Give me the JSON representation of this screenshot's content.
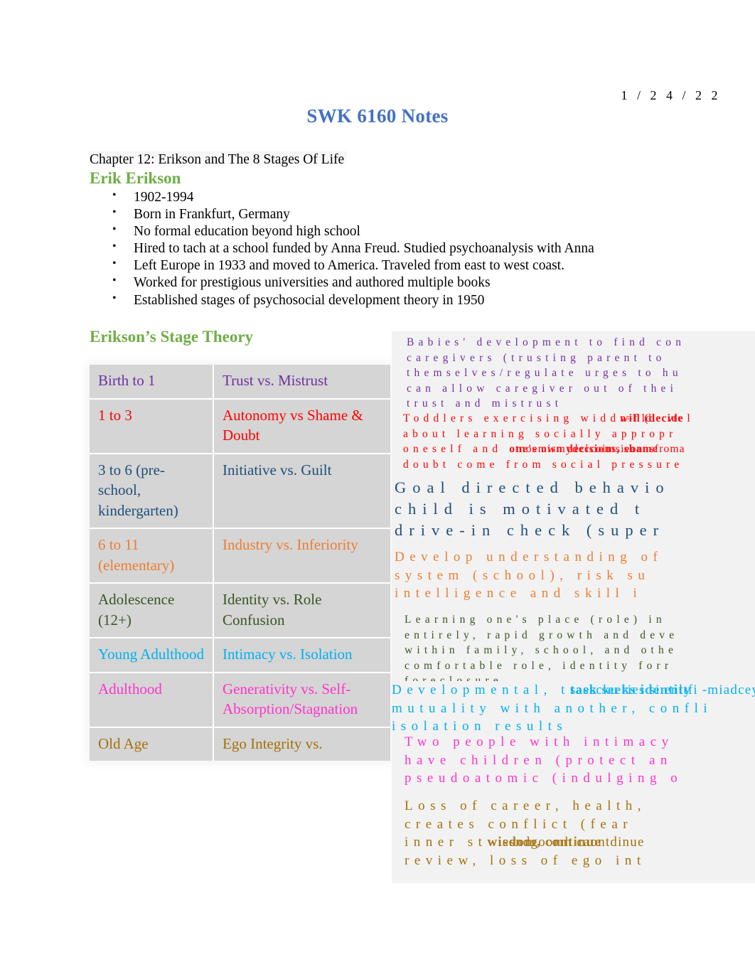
{
  "header": {
    "date": "1 / 2 4 / 2 2",
    "title": "SWK 6160 Notes"
  },
  "chapter": {
    "line": "Chapter 12: Erikson and The 8 Stages Of Life"
  },
  "sections": {
    "erik_erikson_heading": "Erik Erikson",
    "stage_theory_heading": "Erikson’s Stage Theory"
  },
  "bio_bullets": [
    "1902-1994",
    "Born in Frankfurt, Germany",
    "No formal education beyond high school",
    "Hired to tach at a school funded by Anna Freud. Studied psychoanalysis with Anna",
    "Left Europe in 1933 and moved to America. Traveled from east to west coast.",
    "Worked for prestigious universities and authored multiple books",
    "Established stages of psychosocial development theory in 1950"
  ],
  "stage_table": {
    "rows": [
      {
        "age": "Birth to 1",
        "stage": "Trust vs. Mistrust",
        "color": "#7030a0"
      },
      {
        "age": "1 to 3",
        "stage": "Autonomy vs Shame & Doubt",
        "color": "#ff0000"
      },
      {
        "age": "3 to 6 (pre-school, kindergarten)",
        "stage": "Initiative vs. Guilt",
        "color": "#1f4e79"
      },
      {
        "age": "6 to 11 (elementary)",
        "stage": "Industry vs. Inferiority",
        "color": "#ed7d31"
      },
      {
        "age": "Adolescence (12+)",
        "stage": "Identity vs. Role Confusion",
        "color": "#375623"
      },
      {
        "age": "Young Adulthood",
        "stage": "Intimacy vs. Isolation",
        "color": "#00b0f0"
      },
      {
        "age": "Adulthood",
        "stage": "Generativity vs. Self-Absorption/Stagnation",
        "color": "#ff33cc"
      },
      {
        "age": "Old Age",
        "stage": "Ego Integrity vs.",
        "color": "#a4700b"
      }
    ]
  },
  "descriptions": [
    {
      "color": "#7030a0",
      "size": "small",
      "lines": [
        "Babies' development to find con",
        "caregivers (trusting parent to",
        "themselves/regulate urges to hu",
        "can allow caregiver out of thei",
        "trust and mistrust"
      ]
    },
    {
      "color": "#ff0000",
      "size": "small",
      "lines": [
        "Toddlers exercising wid",
        "about learning socially appropr",
        "oneself and ",
        "doubt come from social pressure"
      ],
      "overlap": {
        "line_index": 0,
        "base_suffix": "d",
        "over_a": "n=f ldiecvte l",
        "over_b": "will (decide"
      },
      "overlap2": {
        "line_index": 2,
        "over_a": "otnoemismydeccoimsieonnsfroma",
        "over_b": "one's own decisions, shame"
      }
    },
    {
      "color": "#1f4e79",
      "size": "big",
      "lines": [
        "Goal directed behavio",
        "child is motivated t",
        "drive-in check (super"
      ]
    },
    {
      "color": "#ed7d31",
      "size": "mid",
      "lines": [
        "Develop understanding of",
        "system (school), risk su",
        "intelligence and skill i"
      ]
    },
    {
      "color": "#375623",
      "size": "small",
      "lines": [
        "Learning one's place (role) in",
        "entirely, rapid growth and deve",
        "within family, school, and othe",
        "comfortable role, identity forr",
        "foreclosure"
      ]
    },
    {
      "color": "#00b0f0",
      "size": "mid",
      "lines": [
        "Developmental, t",
        "mutuality with another, confli",
        "isolation results"
      ],
      "overlap": {
        "line_index": 0,
        "base_suffix": "",
        "over_a": "saescku ries si enltfi -miadcey",
        "over_b": "task seeks identity"
      }
    },
    {
      "color": "#ff33cc",
      "size": "mid",
      "lines": [
        "Two people with intimacy",
        "have children (protect an",
        "pseudoatomic (indulging o"
      ]
    },
    {
      "color": "#a4700b",
      "size": "mid",
      "lines": [
        "Loss of career, health,",
        "creates conflict (fear",
        "inner st",
        "review, loss of ego int"
      ],
      "overlap": {
        "line_index": 2,
        "base_suffix": "",
        "over_a": "wiesndgoomh caontdinue",
        "over_b": "wisdom, continue"
      }
    }
  ]
}
